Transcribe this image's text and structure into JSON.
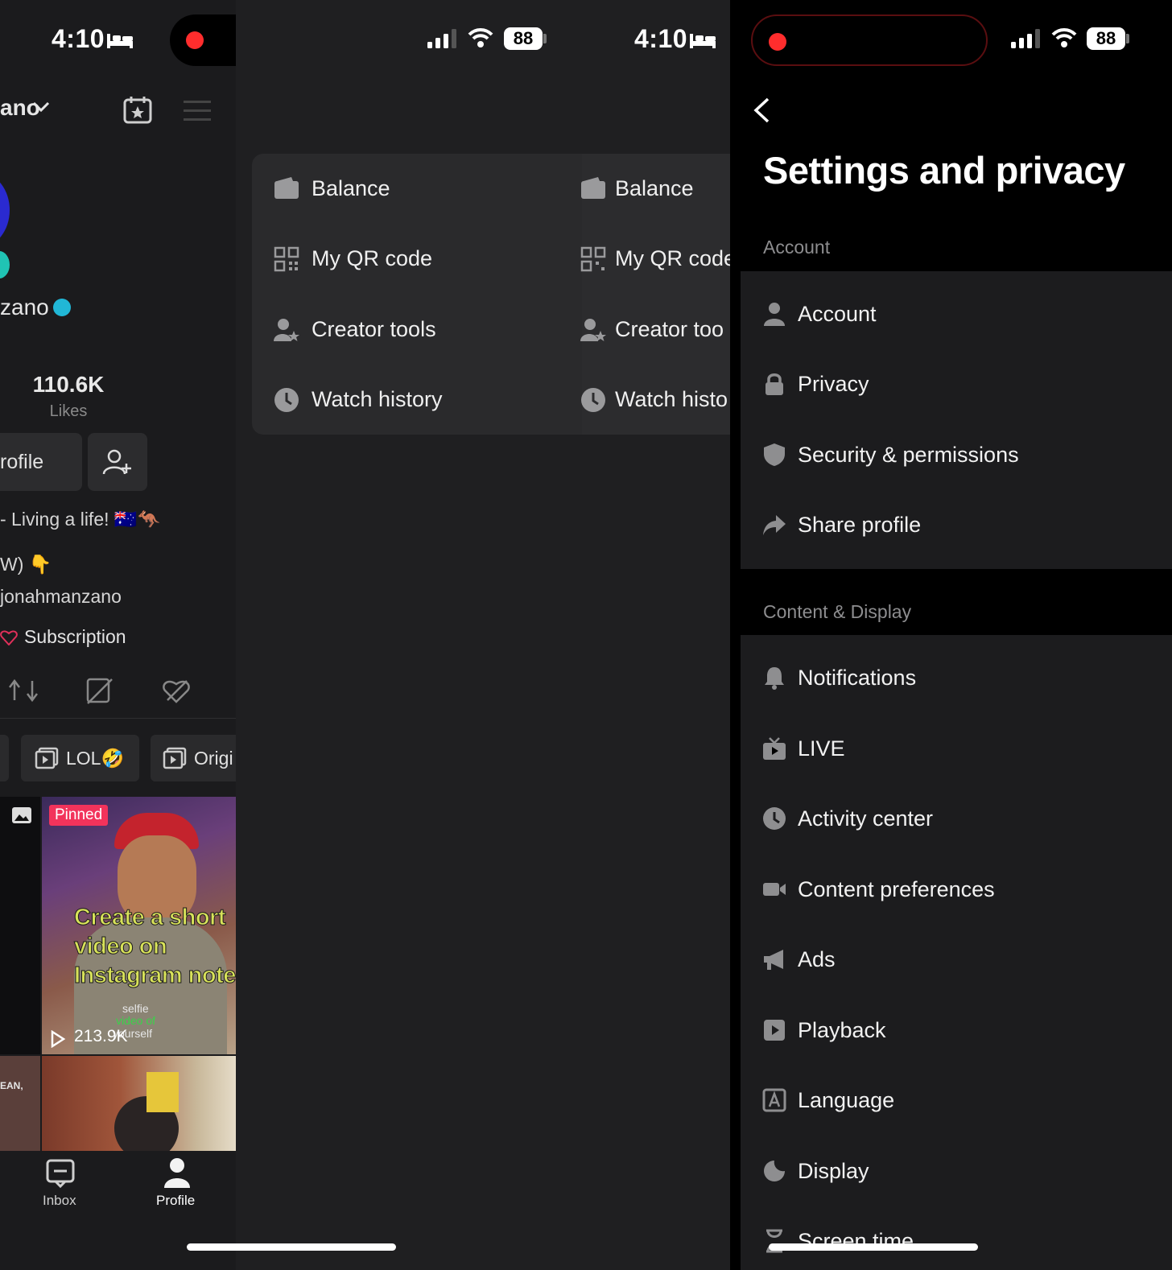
{
  "status_left": {
    "time": "4:10",
    "battery": "88"
  },
  "status_right": {
    "time": "4:10",
    "battery": "88"
  },
  "profile": {
    "username_fragment": "ano",
    "display_name_fragment": "zano",
    "likes_count": "110.6K",
    "likes_label": "Likes",
    "edit_button_fragment": "rofile",
    "bio_line1": "- Living a life! 🇦🇺🦘",
    "bio_line2": "W) 👇",
    "bio_line3": "jonahmanzano",
    "subscription_label": "Subscription",
    "chips": [
      "LOL🤣",
      "Origi"
    ],
    "pinned_label": "Pinned",
    "video_overlay": [
      "Create a short",
      "video on",
      "Instagram note"
    ],
    "video_caption": [
      "selfie",
      "video of",
      "yourself"
    ],
    "views": "213.9K",
    "tile2_caption": "EAN,",
    "nav": {
      "inbox": "Inbox",
      "profile": "Profile"
    }
  },
  "drawer": {
    "items": [
      {
        "label": "Balance",
        "icon": "wallet-icon"
      },
      {
        "label": "My QR code",
        "icon": "qr-code-icon"
      },
      {
        "label": "Creator tools",
        "icon": "creator-tools-icon"
      },
      {
        "label": "Watch history",
        "icon": "clock-icon"
      }
    ],
    "ghost_items": [
      "Balance",
      "My QR code",
      "Creator too",
      "Watch histo"
    ]
  },
  "settings": {
    "title": "Settings and privacy",
    "sections": [
      {
        "label": "Account",
        "items": [
          {
            "label": "Account",
            "icon": "person-icon"
          },
          {
            "label": "Privacy",
            "icon": "lock-icon"
          },
          {
            "label": "Security & permissions",
            "icon": "shield-icon"
          },
          {
            "label": "Share profile",
            "icon": "share-icon"
          }
        ]
      },
      {
        "label": "Content & Display",
        "items": [
          {
            "label": "Notifications",
            "icon": "bell-icon"
          },
          {
            "label": "LIVE",
            "icon": "tv-icon"
          },
          {
            "label": "Activity center",
            "icon": "clock-icon"
          },
          {
            "label": "Content preferences",
            "icon": "video-camera-icon"
          },
          {
            "label": "Ads",
            "icon": "megaphone-icon"
          },
          {
            "label": "Playback",
            "icon": "play-icon"
          },
          {
            "label": "Language",
            "icon": "language-icon"
          },
          {
            "label": "Display",
            "icon": "moon-icon"
          },
          {
            "label": "Screen time",
            "icon": "hourglass-icon"
          }
        ]
      }
    ]
  },
  "colors": {
    "record_dot": "#ff2d2d",
    "pinned_badge": "#f2335b",
    "verified": "#21b7d6"
  }
}
